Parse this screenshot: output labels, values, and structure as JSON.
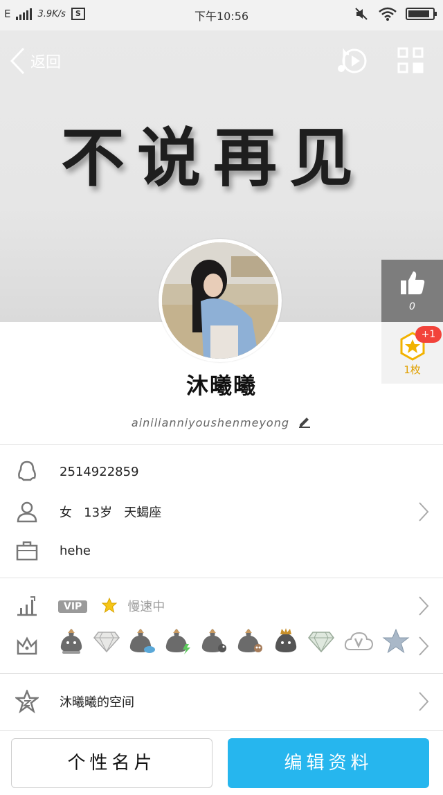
{
  "status_bar": {
    "network": "E",
    "speed": "3.9K/s",
    "time": "下午10:56"
  },
  "header": {
    "back_label": "返回",
    "cover_text": "不说再见"
  },
  "like": {
    "count": "0"
  },
  "badge": {
    "plus": "+1",
    "count": "1枚"
  },
  "profile": {
    "name": "沐曦曦",
    "signature": "ainilianniyoushenmeyong",
    "qq_number": "2514922859",
    "gender": "女",
    "age": "13岁",
    "zodiac": "天蝎座",
    "company": "hehe",
    "vip_tag": "VIP",
    "level_status": "慢速中",
    "space_label": "沐曦曦的空间"
  },
  "buttons": {
    "card": "个性名片",
    "edit": "编辑资料"
  },
  "colors": {
    "accent": "#26b6ee",
    "like_bg": "#7d7d7d",
    "badge_red": "#f2433a"
  }
}
